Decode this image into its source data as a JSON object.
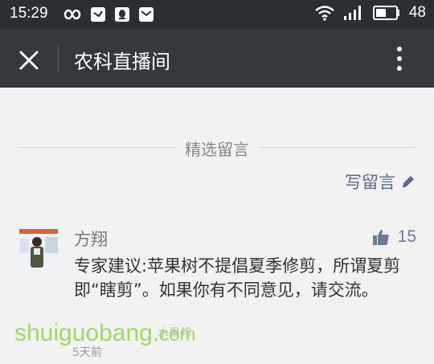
{
  "status_bar": {
    "time": "15:29",
    "battery_text": "48"
  },
  "app_bar": {
    "title": "农科直播间"
  },
  "section": {
    "title": "精选留言",
    "write_label": "写留言"
  },
  "comment": {
    "author": "方翔",
    "likes": "15",
    "text": "专家建议:苹果树不提倡夏季修剪，所谓夏剪即“瞎剪”。如果你有不同意见，请交流。",
    "time": "5天前"
  },
  "watermark": {
    "brand": "shuiguobang.",
    "domain": "com",
    "chinese": "水果邦"
  },
  "colors": {
    "status_bar_bg": "#2b2f33",
    "app_bar_bg": "#35393d",
    "page_bg": "#f2f2f2",
    "link_blue": "#5b6b8a",
    "watermark_green": "#9fd86b"
  }
}
